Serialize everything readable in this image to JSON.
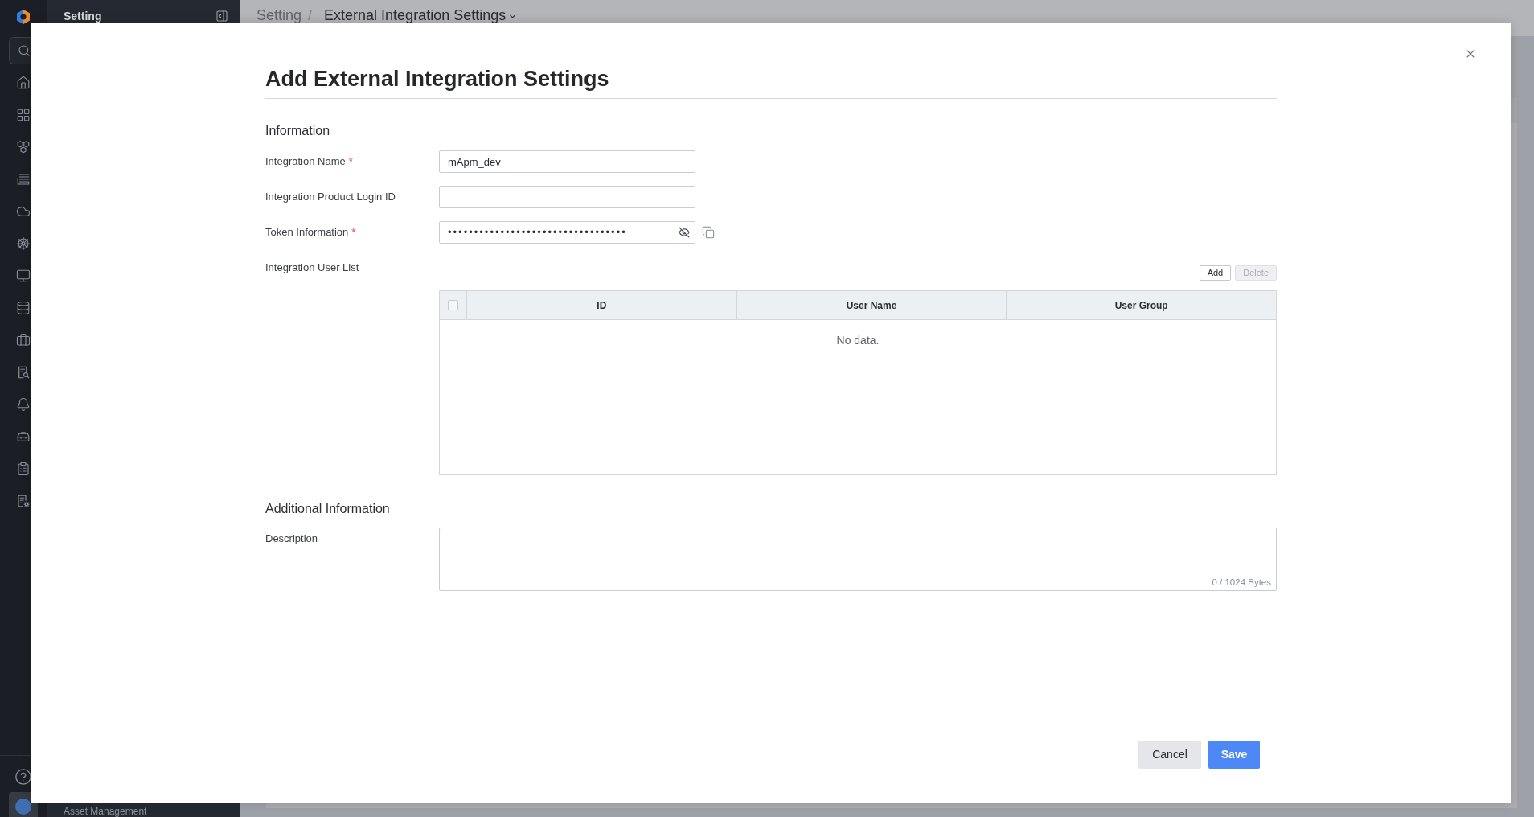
{
  "sidebar": {
    "title": "Setting",
    "items": [
      "Asset Management"
    ]
  },
  "breadcrumb": {
    "separator": "/",
    "items": [
      {
        "label": "Setting",
        "current": false
      },
      {
        "label": "External Integration Settings",
        "current": true
      }
    ]
  },
  "dialog": {
    "title": "Add External Integration Settings",
    "sections": [
      {
        "title": "Information",
        "fields": [
          {
            "kind": "text",
            "label": "Integration Name",
            "required_mark": "*",
            "value": "mApm_dev"
          },
          {
            "kind": "text",
            "label": "Integration Product Login ID"
          },
          {
            "kind": "secret",
            "label": "Token Information",
            "required_mark": "*",
            "value": "••••••••••••••••••••••••••••••••••",
            "masked": true
          },
          {
            "kind": "table",
            "label": "Integration User List",
            "buttons": [
              {
                "label": "Add",
                "disabled": false
              },
              {
                "label": "Delete",
                "disabled": true
              }
            ],
            "select_all_checked": false,
            "columns": [
              "ID",
              "User Name",
              "User Group"
            ],
            "empty_text": "No data."
          }
        ]
      },
      {
        "title": "Additional Information",
        "fields": [
          {
            "kind": "textarea",
            "label": "Description",
            "counter": "0 / 1024 Bytes"
          }
        ]
      }
    ],
    "buttons": [
      {
        "label": "Cancel",
        "kind": "secondary"
      },
      {
        "label": "Save",
        "kind": "primary"
      }
    ]
  }
}
